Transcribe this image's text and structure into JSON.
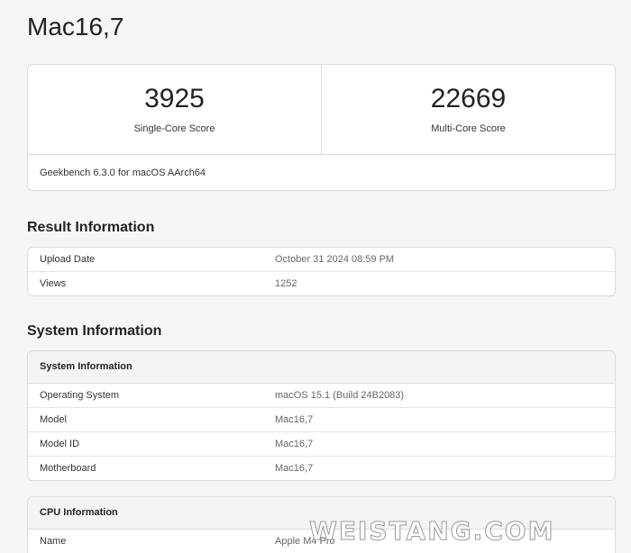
{
  "title": "Mac16,7",
  "scores": {
    "single": {
      "value": "3925",
      "label": "Single-Core Score"
    },
    "multi": {
      "value": "22669",
      "label": "Multi-Core Score"
    },
    "footer": "Geekbench 6.3.0 for macOS AArch64"
  },
  "result_info": {
    "heading": "Result Information",
    "rows": [
      {
        "key": "Upload Date",
        "value": "October 31 2024 08:59 PM"
      },
      {
        "key": "Views",
        "value": "1252"
      }
    ]
  },
  "system_info": {
    "heading": "System Information",
    "table_title": "System Information",
    "rows": [
      {
        "key": "Operating System",
        "value": "macOS 15.1 (Build 24B2083)"
      },
      {
        "key": "Model",
        "value": "Mac16,7"
      },
      {
        "key": "Model ID",
        "value": "Mac16,7"
      },
      {
        "key": "Motherboard",
        "value": "Mac16,7"
      }
    ]
  },
  "cpu_info": {
    "table_title": "CPU Information",
    "rows": [
      {
        "key": "Name",
        "value": "Apple M4 Pro"
      }
    ]
  },
  "watermark": "WEISTANG.COM"
}
